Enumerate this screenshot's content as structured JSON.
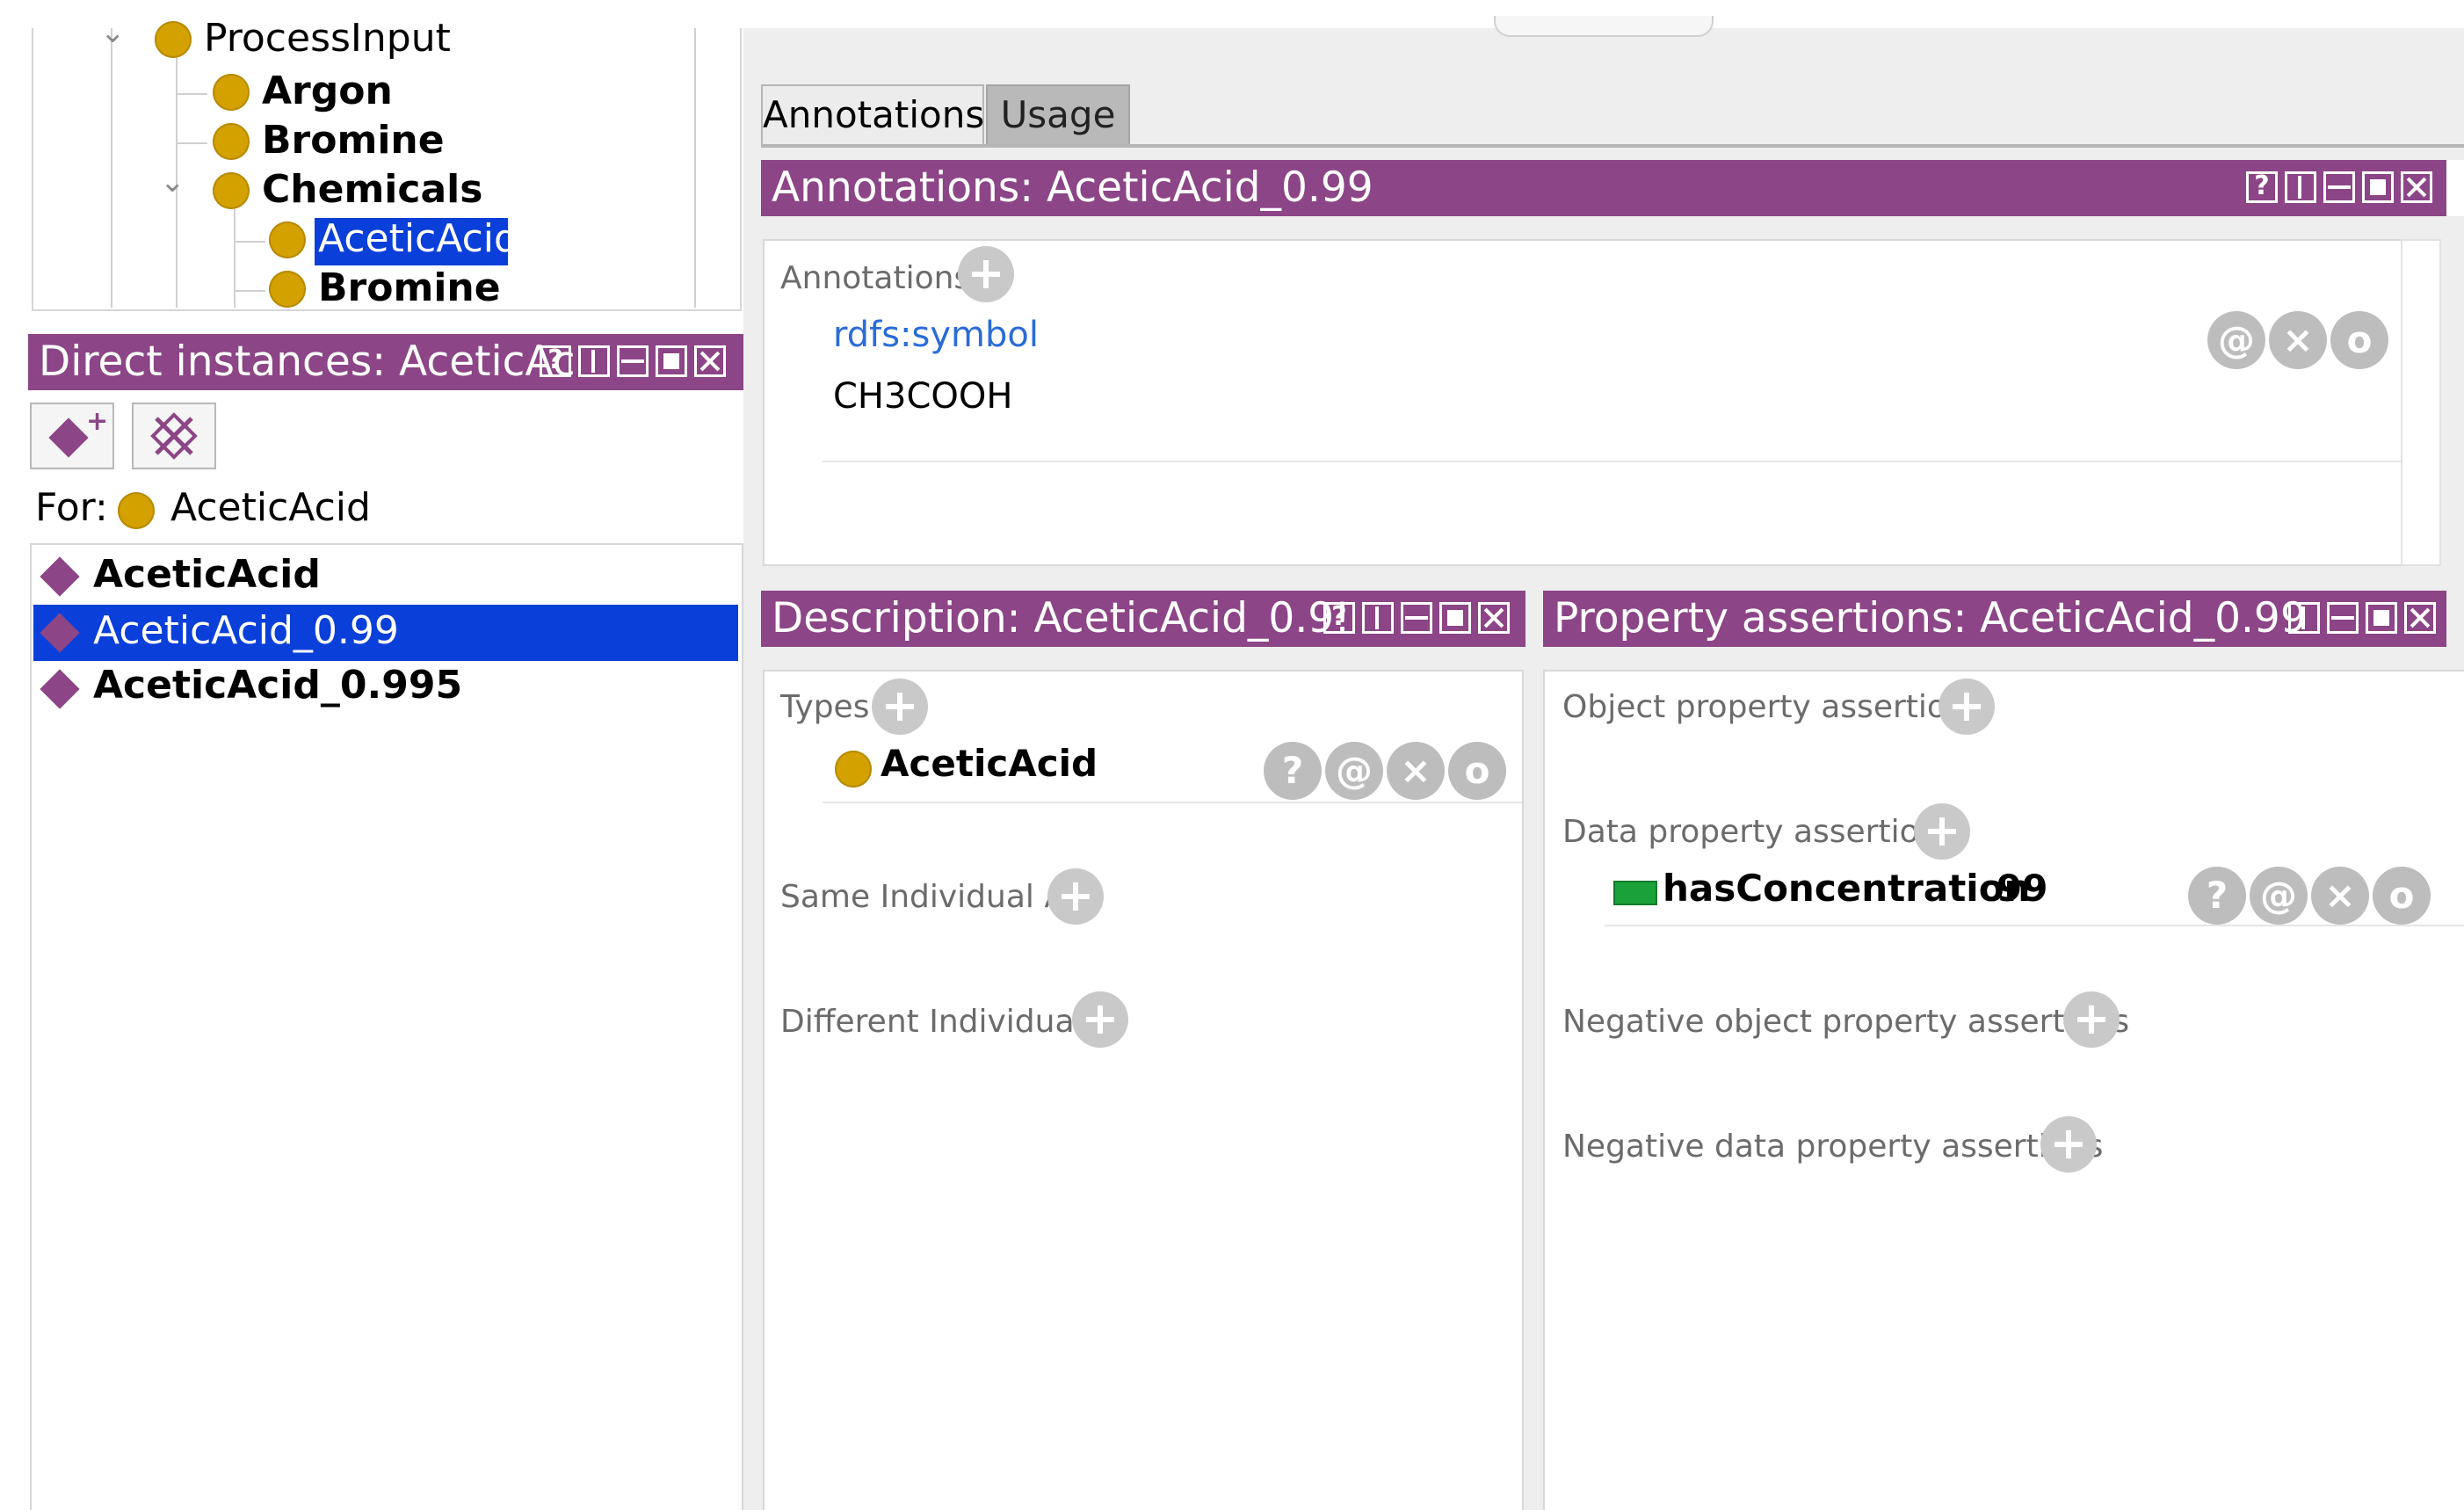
{
  "class_tree": {
    "items": [
      {
        "label": "ProcessInput"
      },
      {
        "label": "Argon"
      },
      {
        "label": "Bromine"
      },
      {
        "label": "Chemicals"
      },
      {
        "label": "AceticAcid"
      },
      {
        "label": "Bromine"
      }
    ]
  },
  "direct_instances": {
    "title": "Direct instances: AceticAc",
    "for_label": "For:",
    "for_class": "AceticAcid",
    "items": [
      {
        "label": "AceticAcid"
      },
      {
        "label": "AceticAcid_0.99"
      },
      {
        "label": "AceticAcid_0.995"
      }
    ]
  },
  "tabs": [
    {
      "label": "Annotations"
    },
    {
      "label": "Usage"
    }
  ],
  "annotations_panel": {
    "title": "Annotations: AceticAcid_0.99",
    "section": "Annotations",
    "property": "rdfs:symbol",
    "value": "CH3COOH"
  },
  "description_panel": {
    "title": "Description: AceticAcid_0.9!",
    "types_label": "Types",
    "type_value": "AceticAcid",
    "same_label": "Same Individual As",
    "different_label": "Different Individuals"
  },
  "property_panel": {
    "title": "Property assertions: AceticAcid_0.99",
    "object_label": "Object property assertions",
    "data_label": "Data property assertions",
    "data_property": "hasConcentration",
    "data_value": "99",
    "neg_object_label": "Negative object property assertions",
    "neg_data_label": "Negative data property assertions"
  },
  "icons": {
    "help": "?",
    "annotate": "@",
    "delete": "×",
    "edit": "o"
  },
  "colors": {
    "panel_header": "#8c4586",
    "selection": "#0a3fd9",
    "class_icon": "#d3a100",
    "individual_icon": "#8c4586",
    "data_property_icon": "#1aa13a",
    "link": "#2a6cd6"
  }
}
